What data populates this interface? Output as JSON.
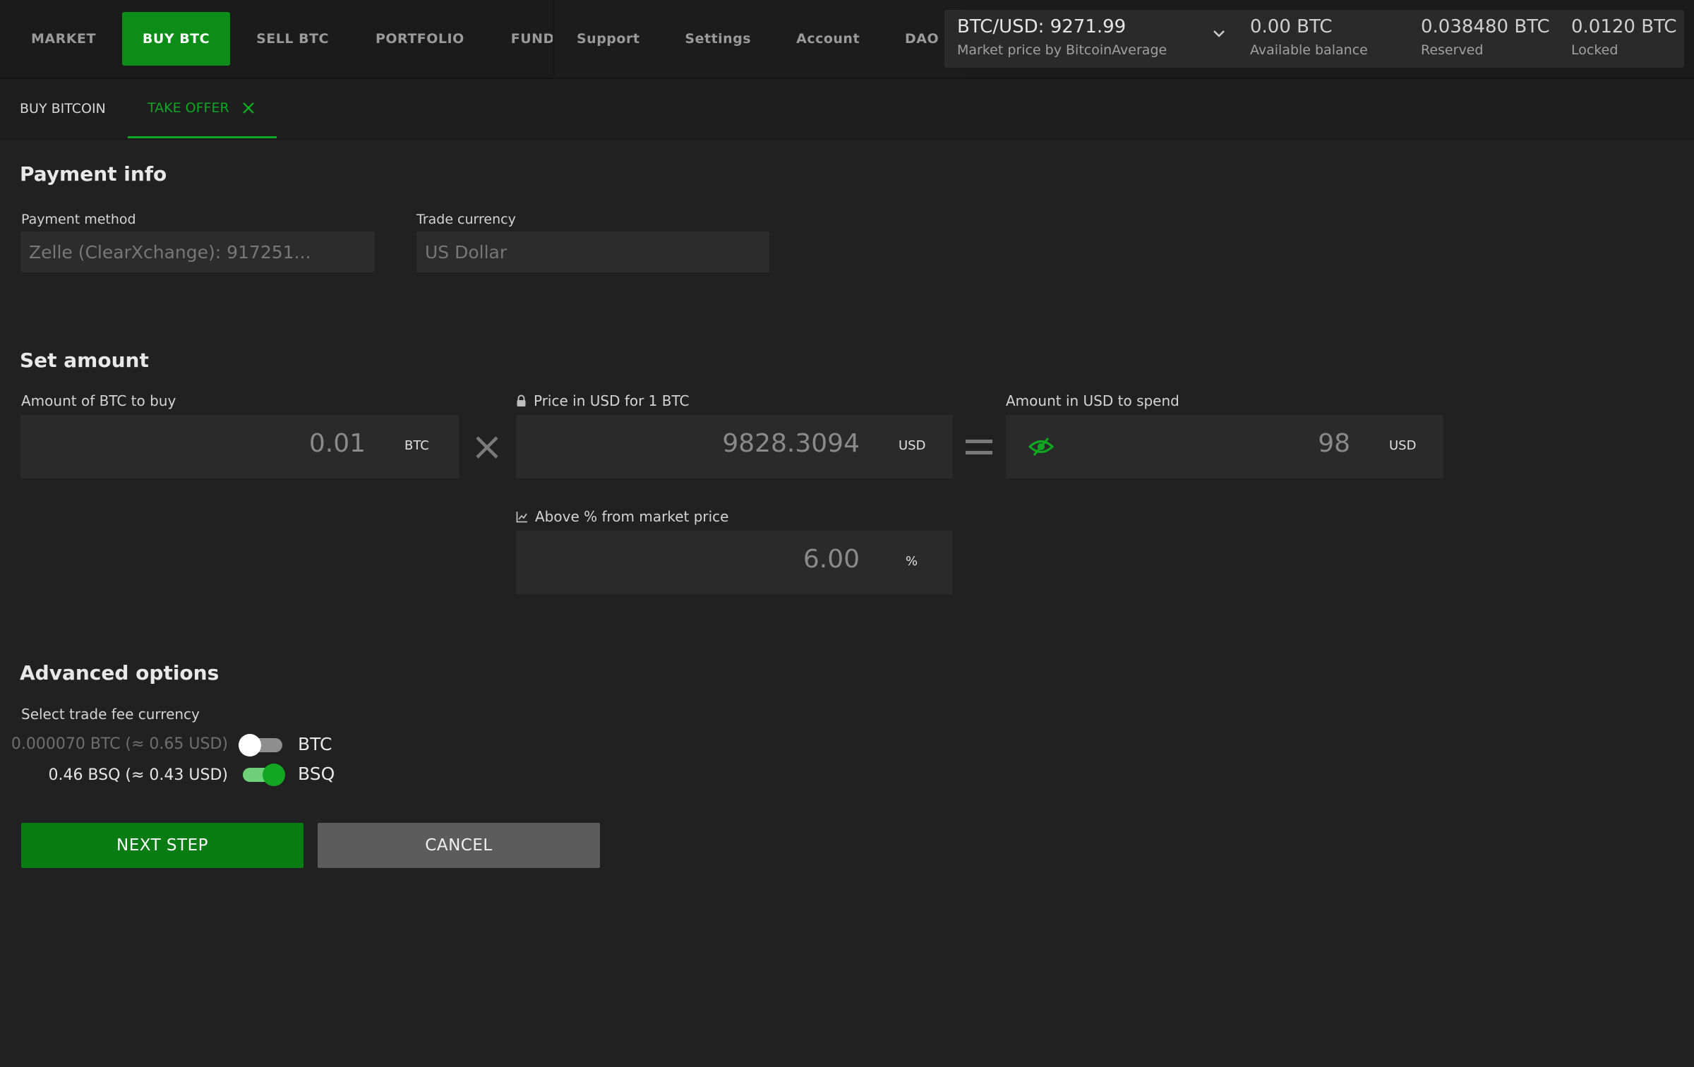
{
  "nav": {
    "left": [
      "MARKET",
      "BUY BTC",
      "SELL BTC",
      "PORTFOLIO",
      "FUNDS"
    ],
    "active": "BUY BTC",
    "right": [
      "Support",
      "Settings",
      "Account",
      "DAO"
    ]
  },
  "ticker": {
    "pair_price": "BTC/USD: 9271.99",
    "pair_sub": "Market price by BitcoinAverage",
    "available_value": "0.00 BTC",
    "available_label": "Available balance",
    "reserved_value": "0.038480 BTC",
    "reserved_label": "Reserved",
    "locked_value": "0.0120 BTC",
    "locked_label": "Locked"
  },
  "tabs": {
    "buy_bitcoin": "BUY BITCOIN",
    "take_offer": "TAKE OFFER"
  },
  "payment_info": {
    "title": "Payment info",
    "method_label": "Payment method",
    "method_value": "Zelle (ClearXchange): 917251...",
    "currency_label": "Trade currency",
    "currency_value": "US Dollar"
  },
  "set_amount": {
    "title": "Set amount",
    "btc_label": "Amount of BTC to buy",
    "btc_value": "0.01",
    "btc_unit": "BTC",
    "price_label": "Price in USD for 1 BTC",
    "price_value": "9828.3094",
    "price_unit": "USD",
    "usd_label": "Amount in USD to spend",
    "usd_value": "98",
    "usd_unit": "USD",
    "pct_label": "Above % from market price",
    "pct_value": "6.00",
    "pct_unit": "%"
  },
  "advanced": {
    "title": "Advanced options",
    "fee_currency_label": "Select trade fee currency",
    "btc_fee": "0.000070 BTC (≈ 0.65 USD)",
    "btc_toggle_label": "BTC",
    "btc_toggle_on": false,
    "bsq_fee": "0.46 BSQ (≈ 0.43 USD)",
    "bsq_toggle_label": "BSQ",
    "bsq_toggle_on": true
  },
  "actions": {
    "next": "NEXT STEP",
    "cancel": "CANCEL"
  },
  "colors": {
    "accent": "#0b8d18",
    "accent_text": "#0fa821",
    "background": "#212121"
  }
}
